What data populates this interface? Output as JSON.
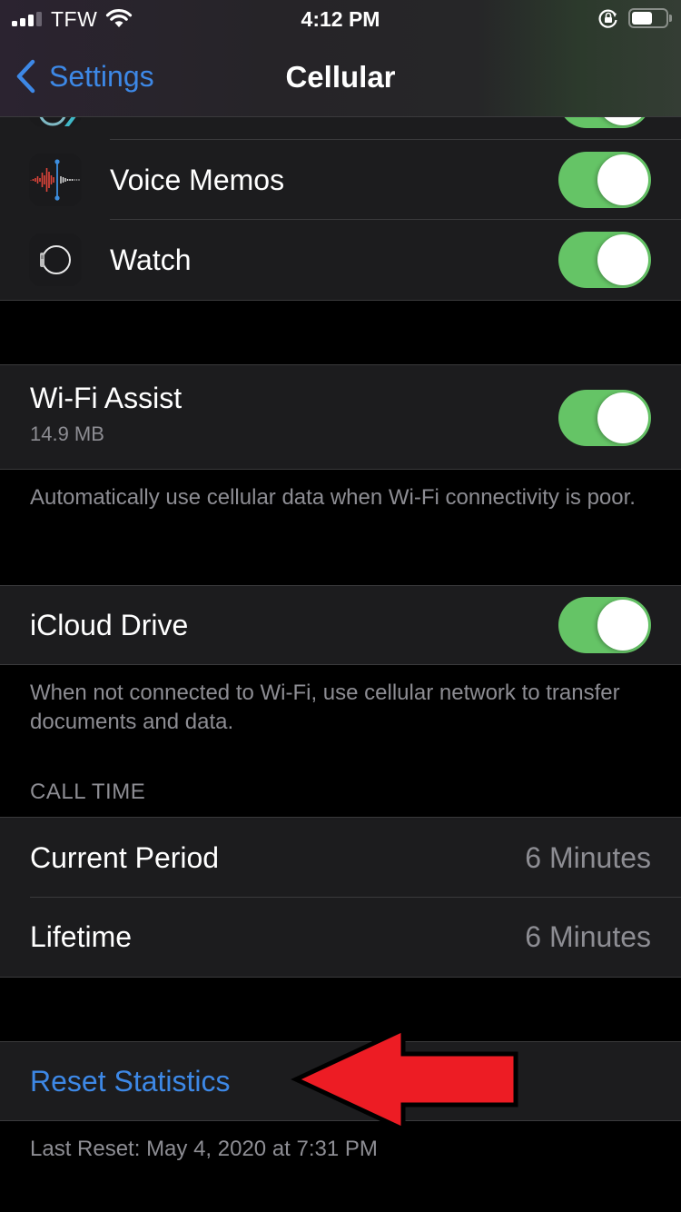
{
  "status_bar": {
    "carrier": "TFW",
    "time": "4:12 PM",
    "signal_bars_active": 3,
    "signal_bars_total": 4,
    "icons": [
      "signal-icon",
      "wifi-icon",
      "rotation-lock-icon",
      "battery-icon"
    ],
    "battery_level": 0.55
  },
  "nav": {
    "back_label": "Settings",
    "title": "Cellular"
  },
  "apps": [
    {
      "label": "",
      "icon": "app-icon-partial",
      "enabled": true
    },
    {
      "label": "Voice Memos",
      "icon": "voice-memos-icon",
      "enabled": true
    },
    {
      "label": "Watch",
      "icon": "watch-icon",
      "enabled": true
    }
  ],
  "wifi_assist": {
    "label": "Wi-Fi Assist",
    "usage": "14.9 MB",
    "enabled": true,
    "footer": "Automatically use cellular data when Wi-Fi connectivity is poor."
  },
  "icloud_drive": {
    "label": "iCloud Drive",
    "enabled": true,
    "footer": "When not connected to Wi-Fi, use cellular network to transfer documents and data."
  },
  "call_time": {
    "header": "CALL TIME",
    "rows": [
      {
        "label": "Current Period",
        "value": "6 Minutes"
      },
      {
        "label": "Lifetime",
        "value": "6 Minutes"
      }
    ]
  },
  "reset": {
    "label": "Reset Statistics",
    "last_reset": "Last Reset: May 4, 2020 at 7:31 PM"
  },
  "annotation": {
    "type": "arrow",
    "direction": "left",
    "points_to": "Reset Statistics",
    "color": "#ed1c24"
  },
  "colors": {
    "accent": "#3d88e6",
    "toggle_on": "#65c466",
    "cell_bg": "#1c1c1e",
    "secondary_text": "#8d8d93"
  }
}
